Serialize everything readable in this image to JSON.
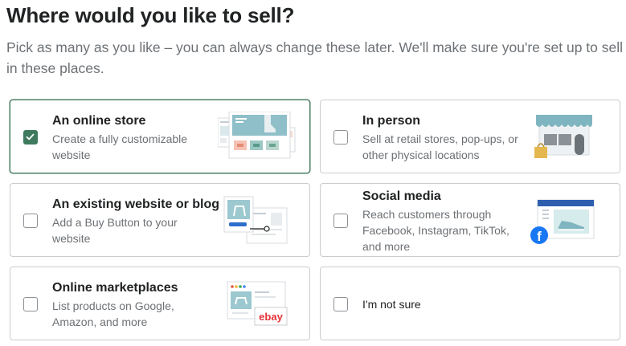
{
  "page": {
    "title": "Where would you like to sell?",
    "subtitle": "Pick as many as you like – you can always change these later. We'll make sure you're set up to sell in these places."
  },
  "options": [
    {
      "title": "An online store",
      "description": "Create a fully customizable website",
      "checked": true,
      "illustration": "online-store-illustration"
    },
    {
      "title": "In person",
      "description": "Sell at retail stores, pop-ups, or other physical locations",
      "checked": false,
      "illustration": "storefront-illustration"
    },
    {
      "title": "An existing website or blog",
      "description": "Add a Buy Button to your website",
      "checked": false,
      "illustration": "buy-button-illustration"
    },
    {
      "title": "Social media",
      "description": "Reach customers through Facebook, Instagram, TikTok, and more",
      "checked": false,
      "illustration": "social-media-illustration"
    },
    {
      "title": "Online marketplaces",
      "description": "List products on Google, Amazon, and more",
      "checked": false,
      "illustration": "marketplace-illustration"
    },
    {
      "title": "I'm not sure",
      "checked": false
    }
  ],
  "illustrations": {
    "marketplace_logo_text": "ebay",
    "social_logo_text": "f"
  },
  "colors": {
    "accent_green": "#3f7a5e",
    "selected_border": "#4a7c64",
    "teal": "#7fb5c0",
    "brand_blue": "#1877f2"
  }
}
